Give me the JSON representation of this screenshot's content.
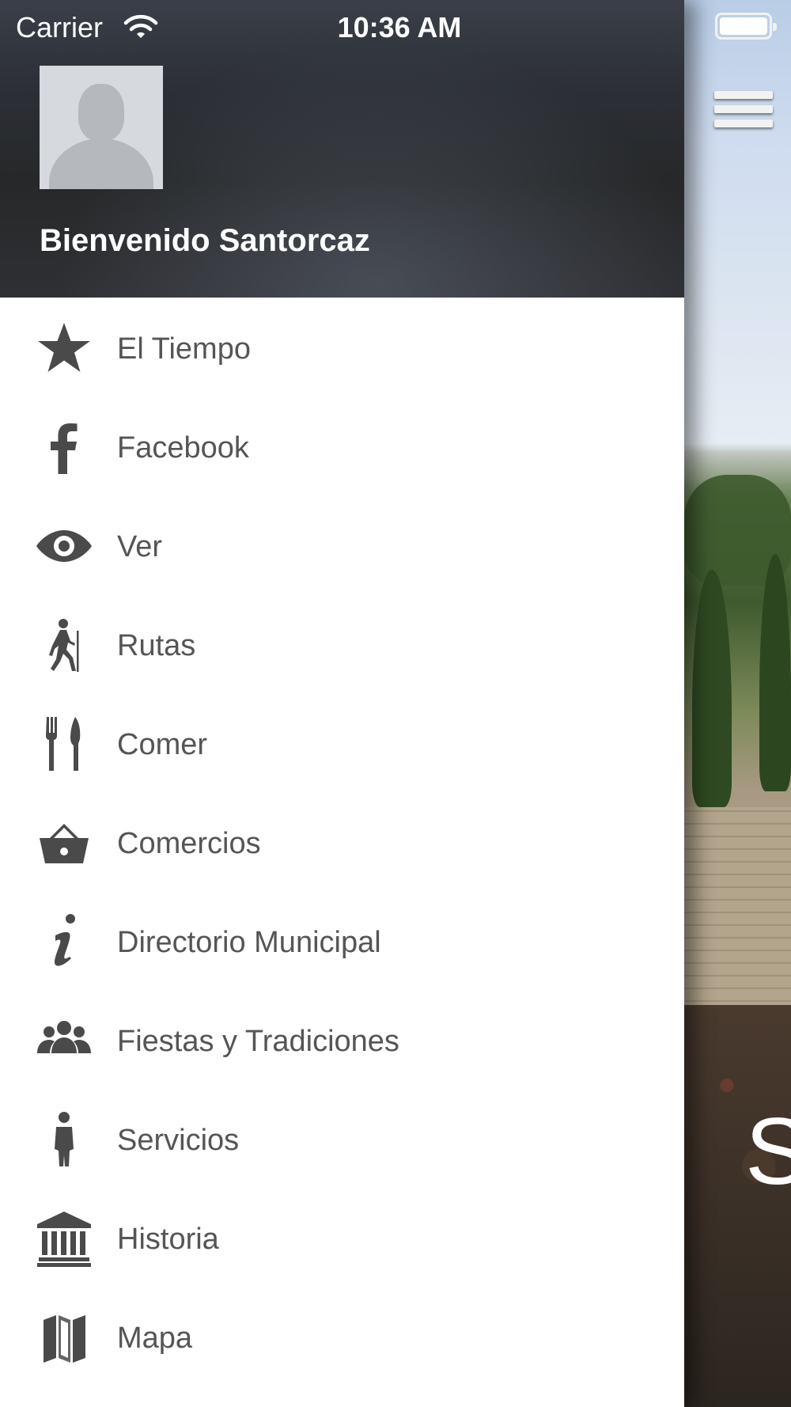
{
  "status_bar": {
    "carrier": "Carrier",
    "time": "10:36 AM"
  },
  "drawer": {
    "welcome": "Bienvenido Santorcaz",
    "items": [
      {
        "label": "El Tiempo",
        "icon": "star-icon"
      },
      {
        "label": "Facebook",
        "icon": "facebook-icon"
      },
      {
        "label": "Ver",
        "icon": "eye-icon"
      },
      {
        "label": "Rutas",
        "icon": "hiker-icon"
      },
      {
        "label": "Comer",
        "icon": "fork-knife-icon"
      },
      {
        "label": "Comercios",
        "icon": "basket-icon"
      },
      {
        "label": "Directorio Municipal",
        "icon": "info-icon"
      },
      {
        "label": "Fiestas y Tradiciones",
        "icon": "group-icon"
      },
      {
        "label": "Servicios",
        "icon": "person-icon"
      },
      {
        "label": "Historia",
        "icon": "museum-icon"
      },
      {
        "label": "Mapa",
        "icon": "map-icon"
      }
    ]
  },
  "main": {
    "partial_title": "S"
  },
  "colors": {
    "menu_text": "#555555",
    "icon": "#4a4a4a",
    "header_bg": "#2c2f36"
  }
}
